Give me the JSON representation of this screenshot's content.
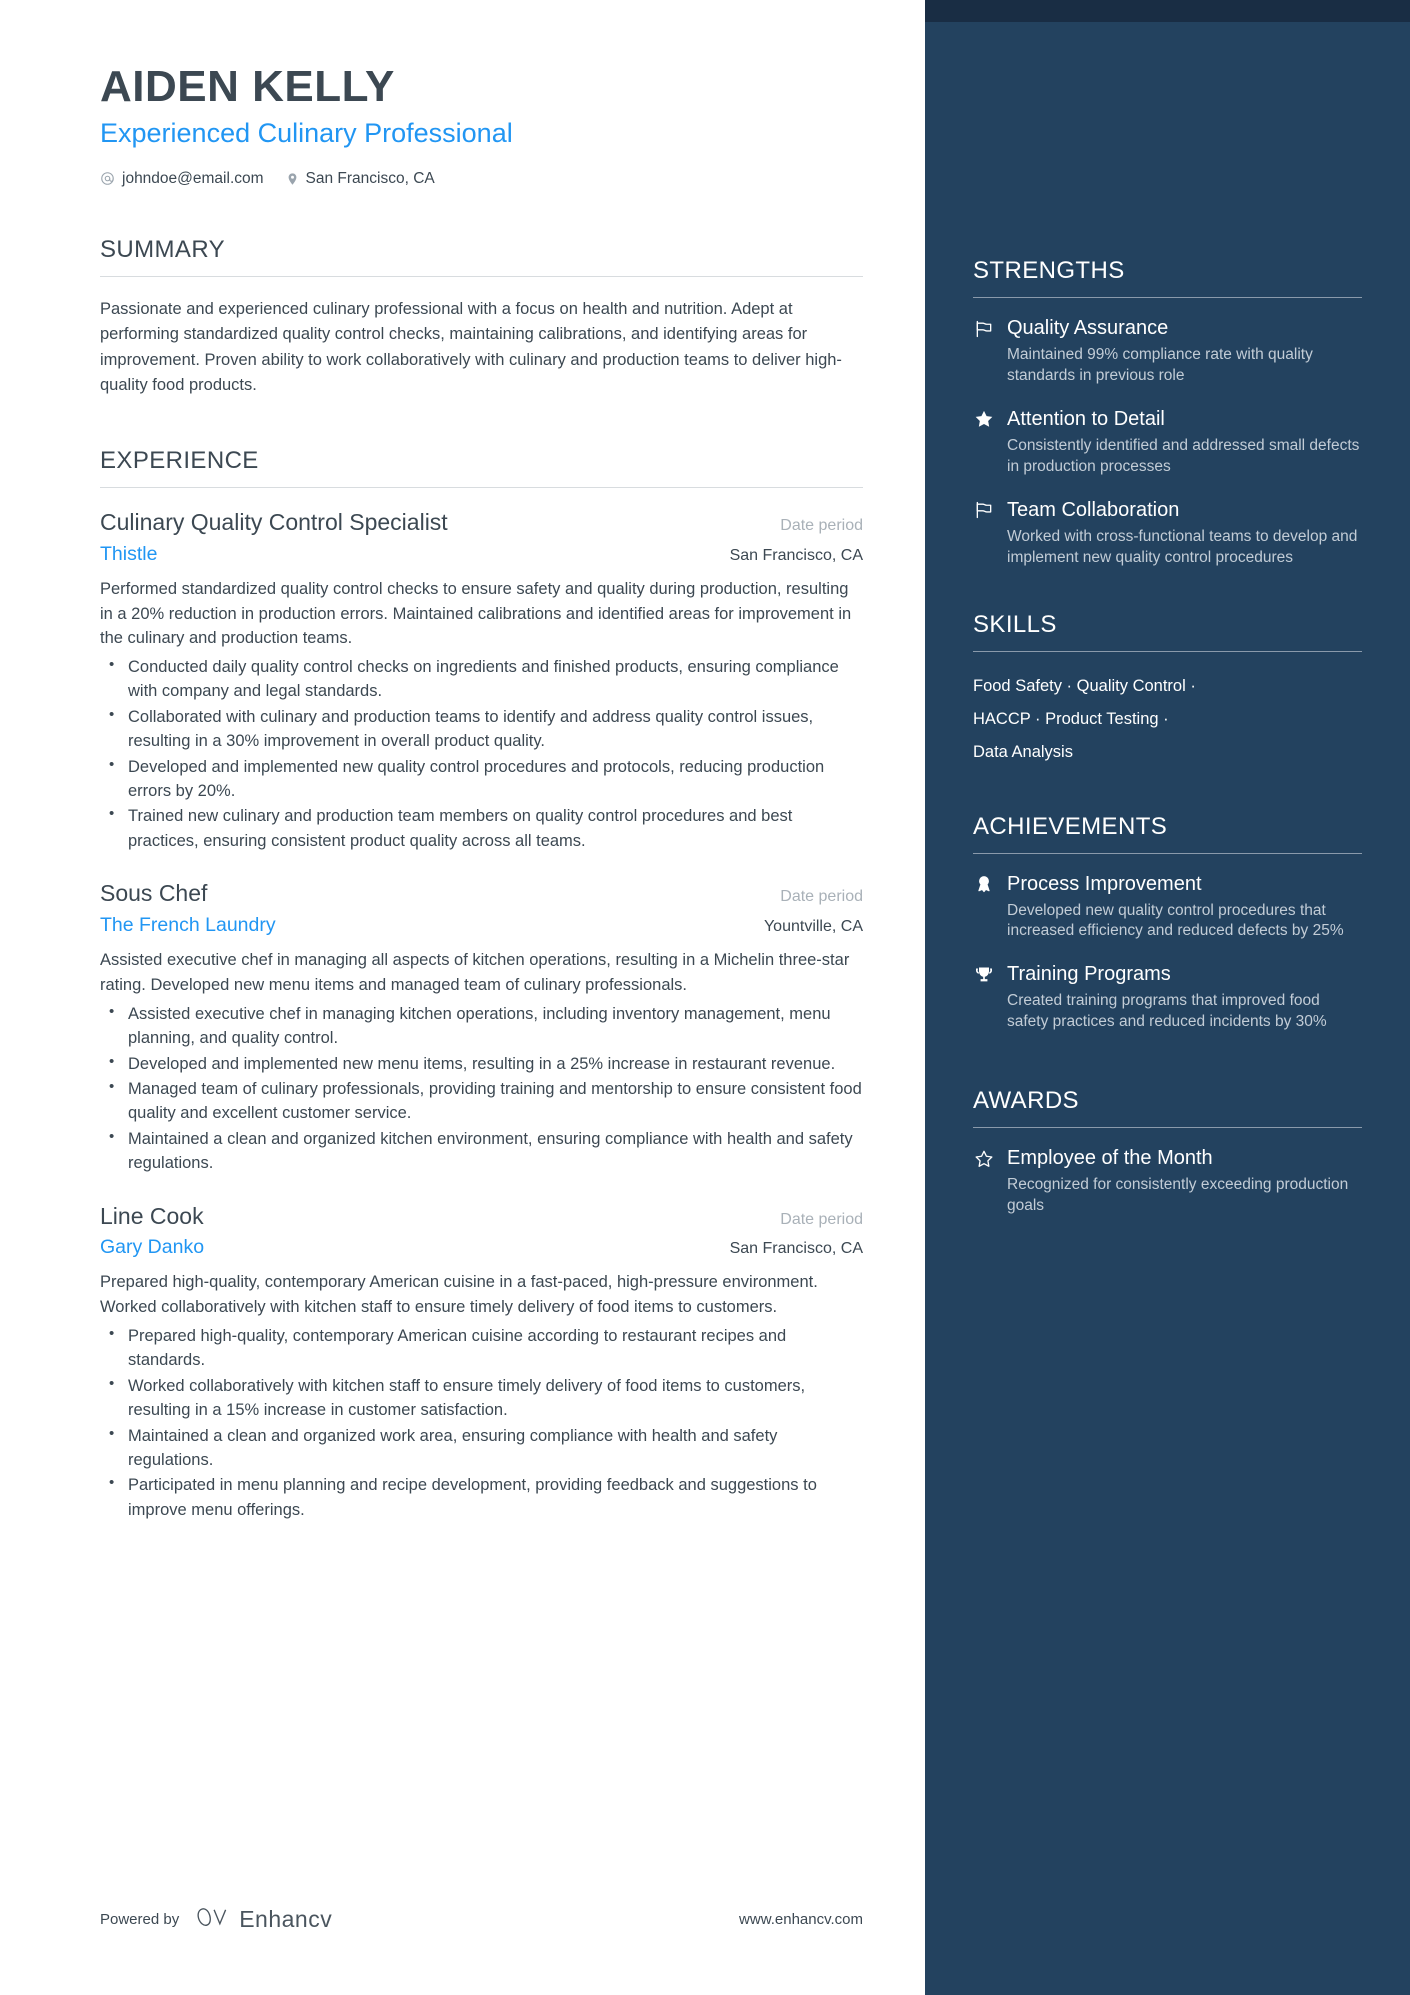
{
  "header": {
    "name": "AIDEN KELLY",
    "title": "Experienced Culinary Professional",
    "email": "johndoe@email.com",
    "location": "San Francisco, CA",
    "email_icon": "at-icon",
    "location_icon": "map-pin-icon"
  },
  "summary": {
    "heading": "SUMMARY",
    "text": "Passionate and experienced culinary professional with a focus on health and nutrition. Adept at performing standardized quality control checks, maintaining calibrations, and identifying areas for improvement. Proven ability to work collaboratively with culinary and production teams to deliver high-quality food products."
  },
  "experience": {
    "heading": "EXPERIENCE",
    "items": [
      {
        "role": "Culinary Quality Control Specialist",
        "dates": "Date period",
        "company": "Thistle",
        "location": "San Francisco, CA",
        "description": "Performed standardized quality control checks to ensure safety and quality during production, resulting in a 20% reduction in production errors. Maintained calibrations and identified areas for improvement in the culinary and production teams.",
        "bullets": [
          "Conducted daily quality control checks on ingredients and finished products, ensuring compliance with company and legal standards.",
          "Collaborated with culinary and production teams to identify and address quality control issues, resulting in a 30% improvement in overall product quality.",
          "Developed and implemented new quality control procedures and protocols, reducing production errors by 20%.",
          "Trained new culinary and production team members on quality control procedures and best practices, ensuring consistent product quality across all teams."
        ]
      },
      {
        "role": "Sous Chef",
        "dates": "Date period",
        "company": "The French Laundry",
        "location": "Yountville, CA",
        "description": "Assisted executive chef in managing all aspects of kitchen operations, resulting in a Michelin three-star rating. Developed new menu items and managed team of culinary professionals.",
        "bullets": [
          "Assisted executive chef in managing kitchen operations, including inventory management, menu planning, and quality control.",
          "Developed and implemented new menu items, resulting in a 25% increase in restaurant revenue.",
          "Managed team of culinary professionals, providing training and mentorship to ensure consistent food quality and excellent customer service.",
          "Maintained a clean and organized kitchen environment, ensuring compliance with health and safety regulations."
        ]
      },
      {
        "role": "Line Cook",
        "dates": "Date period",
        "company": "Gary Danko",
        "location": "San Francisco, CA",
        "description": "Prepared high-quality, contemporary American cuisine in a fast-paced, high-pressure environment. Worked collaboratively with kitchen staff to ensure timely delivery of food items to customers.",
        "bullets": [
          "Prepared high-quality, contemporary American cuisine according to restaurant recipes and standards.",
          "Worked collaboratively with kitchen staff to ensure timely delivery of food items to customers, resulting in a 15% increase in customer satisfaction.",
          "Maintained a clean and organized work area, ensuring compliance with health and safety regulations.",
          "Participated in menu planning and recipe development, providing feedback and suggestions to improve menu offerings."
        ]
      }
    ]
  },
  "strengths": {
    "heading": "STRENGTHS",
    "items": [
      {
        "icon": "flag-icon",
        "title": "Quality Assurance",
        "desc": "Maintained 99% compliance rate with quality standards in previous role"
      },
      {
        "icon": "star-filled-icon",
        "title": "Attention to Detail",
        "desc": "Consistently identified and addressed small defects in production processes"
      },
      {
        "icon": "flag-icon",
        "title": "Team Collaboration",
        "desc": "Worked with cross-functional teams to develop and implement new quality control procedures"
      }
    ]
  },
  "skills": {
    "heading": "SKILLS",
    "separator": "·",
    "lines": [
      "Food Safety · Quality Control ·",
      "HACCP · Product Testing ·",
      "Data Analysis"
    ],
    "items": [
      "Food Safety",
      "Quality Control",
      "HACCP",
      "Product Testing",
      "Data Analysis"
    ]
  },
  "achievements": {
    "heading": "ACHIEVEMENTS",
    "items": [
      {
        "icon": "award-medal-icon",
        "title": "Process Improvement",
        "desc": "Developed new quality control procedures that increased efficiency and reduced defects by 25%"
      },
      {
        "icon": "trophy-icon",
        "title": "Training Programs",
        "desc": "Created training programs that improved food safety practices and reduced incidents by 30%"
      }
    ]
  },
  "awards": {
    "heading": "AWARDS",
    "items": [
      {
        "icon": "star-outline-icon",
        "title": "Employee of the Month",
        "desc": "Recognized for consistently exceeding production goals"
      }
    ]
  },
  "footer": {
    "powered_by": "Powered by",
    "brand": "Enhancv",
    "url": "www.enhancv.com"
  },
  "colors": {
    "accent_blue": "#2196f3",
    "sidebar_bg": "#23425f",
    "sidebar_topbar": "#192d44",
    "text_dark": "#3c4852"
  }
}
